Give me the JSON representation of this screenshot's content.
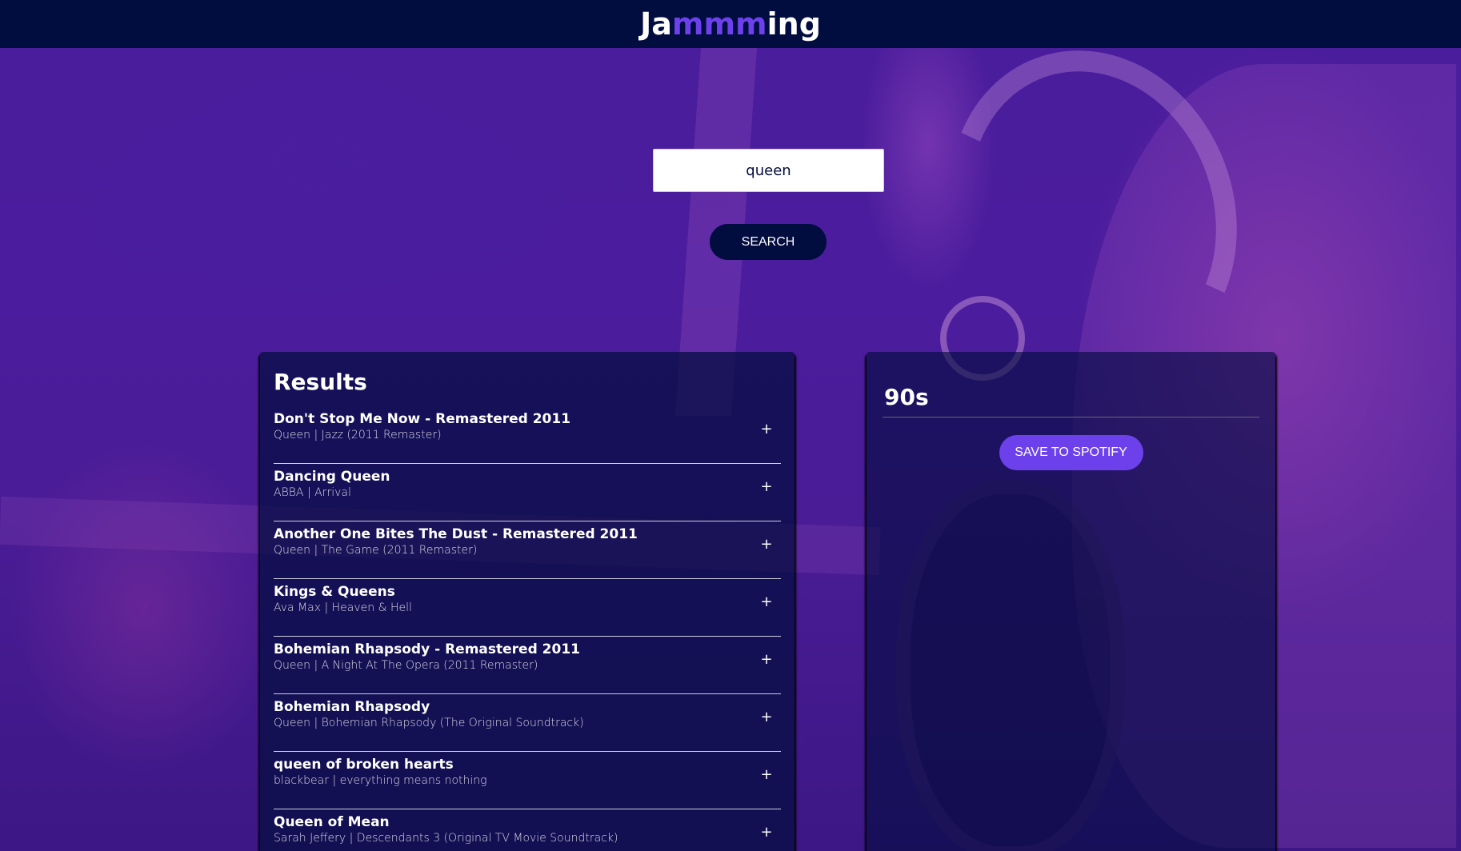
{
  "header": {
    "brand_prefix": "Ja",
    "brand_accent": "mmm",
    "brand_suffix": "ing",
    "accent_color": "#6c41ec",
    "background_color": "#010c3f"
  },
  "search": {
    "value": "queen",
    "button_label": "SEARCH"
  },
  "results": {
    "title": "Results",
    "tracks": [
      {
        "name": "Don't Stop Me Now - Remastered 2011",
        "meta": "Queen | Jazz (2011 Remaster)",
        "action": "+"
      },
      {
        "name": "Dancing Queen",
        "meta": "ABBA | Arrival",
        "action": "+"
      },
      {
        "name": "Another One Bites The Dust - Remastered 2011",
        "meta": "Queen | The Game (2011 Remaster)",
        "action": "+"
      },
      {
        "name": "Kings & Queens",
        "meta": "Ava Max | Heaven & Hell",
        "action": "+"
      },
      {
        "name": "Bohemian Rhapsody - Remastered 2011",
        "meta": "Queen | A Night At The Opera (2011 Remaster)",
        "action": "+"
      },
      {
        "name": "Bohemian Rhapsody",
        "meta": "Queen | Bohemian Rhapsody (The Original Soundtrack)",
        "action": "+"
      },
      {
        "name": "queen of broken hearts",
        "meta": "blackbear | everything means nothing",
        "action": "+"
      },
      {
        "name": "Queen of Mean",
        "meta": "Sarah Jeffery | Descendants 3 (Original TV Movie Soundtrack)",
        "action": "+"
      }
    ]
  },
  "playlist": {
    "name": "90s",
    "save_label": "SAVE TO SPOTIFY"
  }
}
